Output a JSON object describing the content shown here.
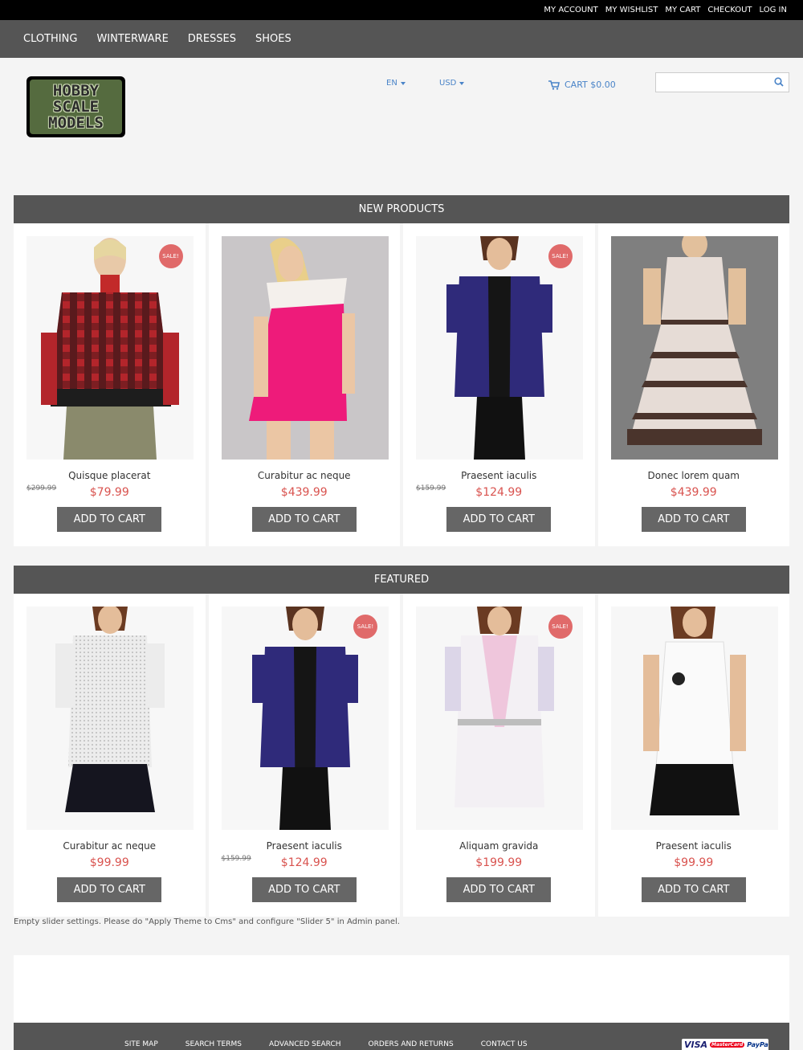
{
  "top_links": [
    "MY ACCOUNT",
    "MY WISHLIST",
    "MY CART",
    "CHECKOUT",
    "LOG IN"
  ],
  "nav": [
    "CLOTHING",
    "WINTERWARE",
    "DRESSES",
    "SHOES"
  ],
  "logo": {
    "lines": [
      "HOBBY",
      "SCALE",
      "MODELS"
    ]
  },
  "language": "EN",
  "currency": "USD",
  "cart_label": "CART $0.00",
  "search": {
    "placeholder": ""
  },
  "sections": [
    {
      "title": "NEW PRODUCTS",
      "products": [
        {
          "name": "Quisque placerat",
          "price": "$79.99",
          "old_price": "$299.99",
          "sale": "SALE!"
        },
        {
          "name": "Curabitur ac neque",
          "price": "$439.99",
          "old_price": "",
          "sale": ""
        },
        {
          "name": "Praesent iaculis",
          "price": "$124.99",
          "old_price": "$159.99",
          "sale": "SALE!"
        },
        {
          "name": "Donec lorem quam",
          "price": "$439.99",
          "old_price": "",
          "sale": ""
        }
      ]
    },
    {
      "title": "FEATURED",
      "products": [
        {
          "name": "Curabitur ac neque",
          "price": "$99.99",
          "old_price": "",
          "sale": ""
        },
        {
          "name": "Praesent iaculis",
          "price": "$124.99",
          "old_price": "$159.99",
          "sale": "SALE!"
        },
        {
          "name": "Aliquam gravida",
          "price": "$199.99",
          "old_price": "",
          "sale": "SALE!"
        },
        {
          "name": "Praesent iaculis",
          "price": "$99.99",
          "old_price": "",
          "sale": ""
        }
      ]
    }
  ],
  "add_to_cart_label": "ADD TO CART",
  "slider_note": "Empty slider settings. Please do \"Apply Theme to Cms\" and configure \"Slider 5\" in Admin panel.",
  "footer_links": [
    "SITE MAP",
    "SEARCH TERMS",
    "ADVANCED SEARCH",
    "ORDERS AND RETURNS",
    "CONTACT US"
  ],
  "payment_logos": [
    "VISA",
    "MasterCard",
    "PayPal"
  ],
  "colors": {
    "topbar": "#000000",
    "nav": "#555555",
    "link": "#4a84c8",
    "price": "#d9534f",
    "sale_badge": "#e06a6a",
    "button": "#666666"
  }
}
